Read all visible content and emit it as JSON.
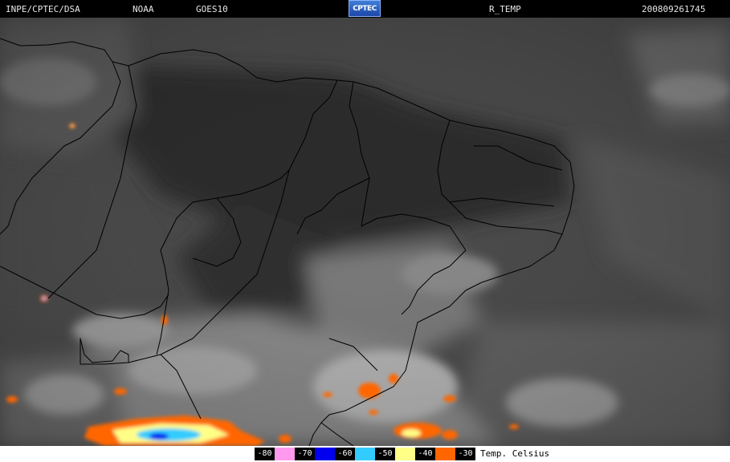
{
  "header": {
    "institution": "INPE/CPTEC/DSA",
    "agency": "NOAA",
    "satellite": "GOES10",
    "logo_text": "CPTEC",
    "product": "R_TEMP",
    "datetime": "200809261745"
  },
  "legend": {
    "title": "Temp. Celsius",
    "items": [
      {
        "label": "-80",
        "color": "#ff99ee"
      },
      {
        "label": "-70",
        "color": "#0000ee"
      },
      {
        "label": "-60",
        "color": "#33ccff"
      },
      {
        "label": "-50",
        "color": "#ffff88"
      },
      {
        "label": "-40",
        "color": "#ff6600"
      },
      {
        "label": "-30",
        "color": "#ff6600"
      }
    ]
  }
}
